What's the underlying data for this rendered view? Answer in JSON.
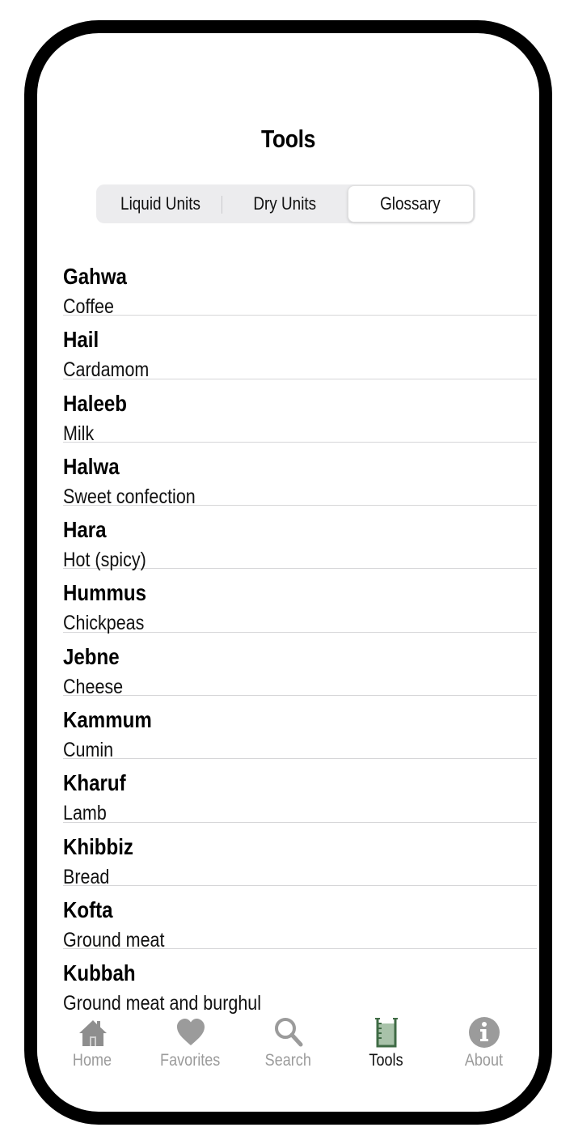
{
  "header": {
    "title": "Tools"
  },
  "segmented": {
    "options": [
      "Liquid Units",
      "Dry Units",
      "Glossary"
    ],
    "selected": "Glossary"
  },
  "glossary": [
    {
      "term": "Gahwa",
      "meaning": "Coffee"
    },
    {
      "term": "Hail",
      "meaning": "Cardamom"
    },
    {
      "term": "Haleeb",
      "meaning": "Milk"
    },
    {
      "term": "Halwa",
      "meaning": "Sweet confection"
    },
    {
      "term": "Hara",
      "meaning": "Hot (spicy)"
    },
    {
      "term": "Hummus",
      "meaning": "Chickpeas"
    },
    {
      "term": "Jebne",
      "meaning": "Cheese"
    },
    {
      "term": "Kammum",
      "meaning": "Cumin"
    },
    {
      "term": "Kharuf",
      "meaning": "Lamb"
    },
    {
      "term": "Khibbiz",
      "meaning": "Bread"
    },
    {
      "term": "Kofta",
      "meaning": "Ground meat"
    },
    {
      "term": "Kubbah",
      "meaning": "Ground meat and burghul"
    }
  ],
  "tabbar": {
    "items": [
      {
        "label": "Home",
        "icon": "home-icon"
      },
      {
        "label": "Favorites",
        "icon": "heart-icon"
      },
      {
        "label": "Search",
        "icon": "search-icon"
      },
      {
        "label": "Tools",
        "icon": "beaker-icon"
      },
      {
        "label": "About",
        "icon": "info-icon"
      }
    ],
    "active": "Tools"
  },
  "colors": {
    "tab_inactive": "#9b9b9b",
    "tab_active_icon": "#3f6b45",
    "tab_active_icon_fill": "#a8c2a9",
    "separator": "#d6d6d8",
    "segment_bg": "#ececee"
  }
}
